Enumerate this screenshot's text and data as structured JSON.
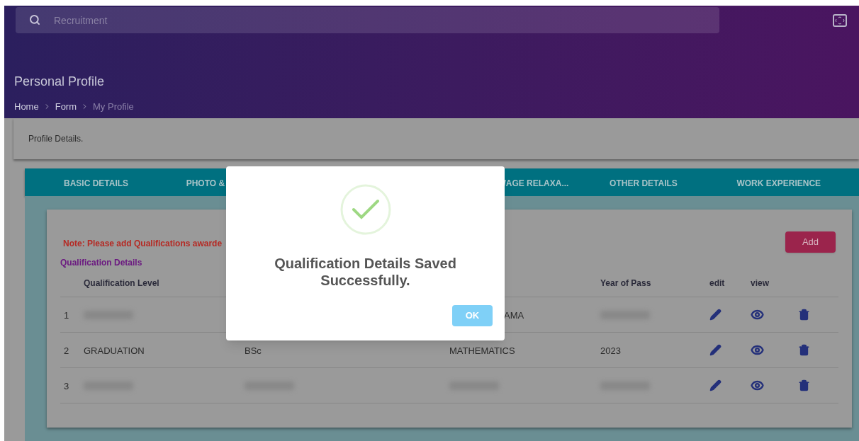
{
  "search": {
    "placeholder": "Recruitment"
  },
  "page_title": "Personal Profile",
  "breadcrumb": [
    {
      "label": "Home",
      "current": false
    },
    {
      "label": "Form",
      "current": false
    },
    {
      "label": "My Profile",
      "current": true
    }
  ],
  "card_title": "Profile Details.",
  "tabs": [
    {
      "label": "BASIC DETAILS"
    },
    {
      "label": "PHOTO &"
    },
    {
      "label": "/AGE RELAXA..."
    },
    {
      "label": "OTHER DETAILS"
    },
    {
      "label": "WORK EXPERIENCE"
    }
  ],
  "note": "Note: Please add Qualifications awarde",
  "add_button": "Add",
  "section_title": "Qualification Details",
  "table": {
    "columns": {
      "level": "Qualification Level",
      "year": "Year of Pass",
      "edit": "edit",
      "view": "view"
    },
    "rows": [
      {
        "index": "1",
        "level": {
          "blurred": true
        },
        "subject": {
          "text": "AMA",
          "covered": true
        },
        "year": {
          "blurred": true
        }
      },
      {
        "index": "2",
        "level": {
          "text": "GRADUATION"
        },
        "course": {
          "text": "BSc"
        },
        "subject": {
          "text": "MATHEMATICS"
        },
        "year": {
          "text": "2023"
        }
      },
      {
        "index": "3",
        "level": {
          "blurred": true
        },
        "course": {
          "blurred": true
        },
        "subject": {
          "blurred": true
        },
        "year": {
          "blurred": true
        }
      }
    ]
  },
  "dialog": {
    "title": "Qualification Details Saved Successfully.",
    "ok": "OK"
  }
}
